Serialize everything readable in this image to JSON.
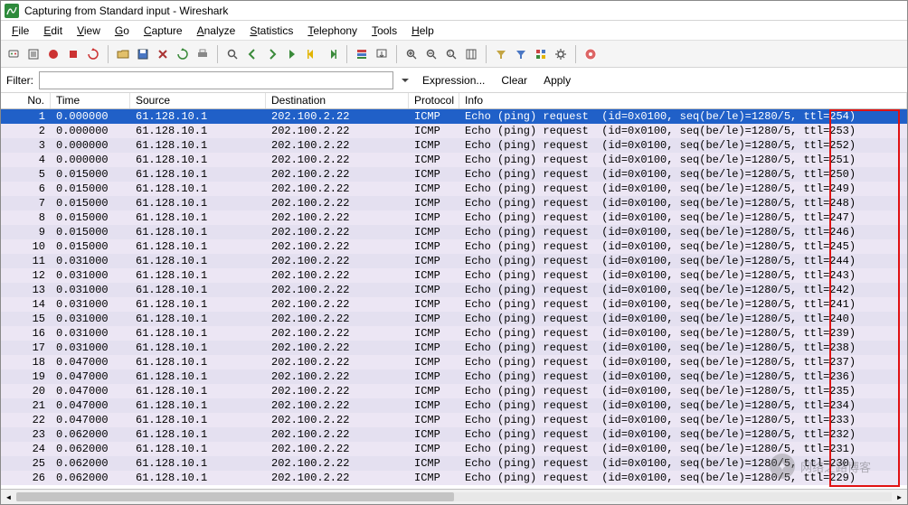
{
  "window": {
    "title": "Capturing from Standard input - Wireshark"
  },
  "menu": {
    "items": [
      "File",
      "Edit",
      "View",
      "Go",
      "Capture",
      "Analyze",
      "Statistics",
      "Telephony",
      "Tools",
      "Help"
    ]
  },
  "toolbar": {
    "groups": [
      [
        "interfaces-icon",
        "options-icon",
        "start-capture-icon",
        "stop-capture-icon",
        "restart-capture-icon"
      ],
      [
        "open-file-icon",
        "save-file-icon",
        "close-file-icon",
        "reload-icon",
        "print-icon"
      ],
      [
        "find-icon",
        "go-back-icon",
        "go-forward-icon",
        "go-to-icon",
        "go-first-icon",
        "go-last-icon"
      ],
      [
        "colorize-icon",
        "auto-scroll-icon"
      ],
      [
        "zoom-in-icon",
        "zoom-out-icon",
        "zoom-reset-icon",
        "resize-columns-icon"
      ],
      [
        "capture-filter-icon",
        "display-filter-icon",
        "coloring-rules-icon",
        "preferences-icon"
      ],
      [
        "help-icon"
      ]
    ]
  },
  "filter": {
    "label": "Filter:",
    "value": "",
    "expression": "Expression...",
    "clear": "Clear",
    "apply": "Apply"
  },
  "columns": [
    "No.",
    "Time",
    "Source",
    "Destination",
    "Protocol",
    "Info"
  ],
  "packets": [
    {
      "no": 1,
      "time": "0.000000",
      "src": "61.128.10.1",
      "dst": "202.100.2.22",
      "proto": "ICMP",
      "info": "Echo (ping) request  (id=0x0100, seq(be/le)=1280/5, ttl=254)",
      "selected": true
    },
    {
      "no": 2,
      "time": "0.000000",
      "src": "61.128.10.1",
      "dst": "202.100.2.22",
      "proto": "ICMP",
      "info": "Echo (ping) request  (id=0x0100, seq(be/le)=1280/5, ttl=253)"
    },
    {
      "no": 3,
      "time": "0.000000",
      "src": "61.128.10.1",
      "dst": "202.100.2.22",
      "proto": "ICMP",
      "info": "Echo (ping) request  (id=0x0100, seq(be/le)=1280/5, ttl=252)"
    },
    {
      "no": 4,
      "time": "0.000000",
      "src": "61.128.10.1",
      "dst": "202.100.2.22",
      "proto": "ICMP",
      "info": "Echo (ping) request  (id=0x0100, seq(be/le)=1280/5, ttl=251)"
    },
    {
      "no": 5,
      "time": "0.015000",
      "src": "61.128.10.1",
      "dst": "202.100.2.22",
      "proto": "ICMP",
      "info": "Echo (ping) request  (id=0x0100, seq(be/le)=1280/5, ttl=250)"
    },
    {
      "no": 6,
      "time": "0.015000",
      "src": "61.128.10.1",
      "dst": "202.100.2.22",
      "proto": "ICMP",
      "info": "Echo (ping) request  (id=0x0100, seq(be/le)=1280/5, ttl=249)"
    },
    {
      "no": 7,
      "time": "0.015000",
      "src": "61.128.10.1",
      "dst": "202.100.2.22",
      "proto": "ICMP",
      "info": "Echo (ping) request  (id=0x0100, seq(be/le)=1280/5, ttl=248)"
    },
    {
      "no": 8,
      "time": "0.015000",
      "src": "61.128.10.1",
      "dst": "202.100.2.22",
      "proto": "ICMP",
      "info": "Echo (ping) request  (id=0x0100, seq(be/le)=1280/5, ttl=247)"
    },
    {
      "no": 9,
      "time": "0.015000",
      "src": "61.128.10.1",
      "dst": "202.100.2.22",
      "proto": "ICMP",
      "info": "Echo (ping) request  (id=0x0100, seq(be/le)=1280/5, ttl=246)"
    },
    {
      "no": 10,
      "time": "0.015000",
      "src": "61.128.10.1",
      "dst": "202.100.2.22",
      "proto": "ICMP",
      "info": "Echo (ping) request  (id=0x0100, seq(be/le)=1280/5, ttl=245)"
    },
    {
      "no": 11,
      "time": "0.031000",
      "src": "61.128.10.1",
      "dst": "202.100.2.22",
      "proto": "ICMP",
      "info": "Echo (ping) request  (id=0x0100, seq(be/le)=1280/5, ttl=244)"
    },
    {
      "no": 12,
      "time": "0.031000",
      "src": "61.128.10.1",
      "dst": "202.100.2.22",
      "proto": "ICMP",
      "info": "Echo (ping) request  (id=0x0100, seq(be/le)=1280/5, ttl=243)"
    },
    {
      "no": 13,
      "time": "0.031000",
      "src": "61.128.10.1",
      "dst": "202.100.2.22",
      "proto": "ICMP",
      "info": "Echo (ping) request  (id=0x0100, seq(be/le)=1280/5, ttl=242)"
    },
    {
      "no": 14,
      "time": "0.031000",
      "src": "61.128.10.1",
      "dst": "202.100.2.22",
      "proto": "ICMP",
      "info": "Echo (ping) request  (id=0x0100, seq(be/le)=1280/5, ttl=241)"
    },
    {
      "no": 15,
      "time": "0.031000",
      "src": "61.128.10.1",
      "dst": "202.100.2.22",
      "proto": "ICMP",
      "info": "Echo (ping) request  (id=0x0100, seq(be/le)=1280/5, ttl=240)"
    },
    {
      "no": 16,
      "time": "0.031000",
      "src": "61.128.10.1",
      "dst": "202.100.2.22",
      "proto": "ICMP",
      "info": "Echo (ping) request  (id=0x0100, seq(be/le)=1280/5, ttl=239)"
    },
    {
      "no": 17,
      "time": "0.031000",
      "src": "61.128.10.1",
      "dst": "202.100.2.22",
      "proto": "ICMP",
      "info": "Echo (ping) request  (id=0x0100, seq(be/le)=1280/5, ttl=238)"
    },
    {
      "no": 18,
      "time": "0.047000",
      "src": "61.128.10.1",
      "dst": "202.100.2.22",
      "proto": "ICMP",
      "info": "Echo (ping) request  (id=0x0100, seq(be/le)=1280/5, ttl=237)"
    },
    {
      "no": 19,
      "time": "0.047000",
      "src": "61.128.10.1",
      "dst": "202.100.2.22",
      "proto": "ICMP",
      "info": "Echo (ping) request  (id=0x0100, seq(be/le)=1280/5, ttl=236)"
    },
    {
      "no": 20,
      "time": "0.047000",
      "src": "61.128.10.1",
      "dst": "202.100.2.22",
      "proto": "ICMP",
      "info": "Echo (ping) request  (id=0x0100, seq(be/le)=1280/5, ttl=235)"
    },
    {
      "no": 21,
      "time": "0.047000",
      "src": "61.128.10.1",
      "dst": "202.100.2.22",
      "proto": "ICMP",
      "info": "Echo (ping) request  (id=0x0100, seq(be/le)=1280/5, ttl=234)"
    },
    {
      "no": 22,
      "time": "0.047000",
      "src": "61.128.10.1",
      "dst": "202.100.2.22",
      "proto": "ICMP",
      "info": "Echo (ping) request  (id=0x0100, seq(be/le)=1280/5, ttl=233)"
    },
    {
      "no": 23,
      "time": "0.062000",
      "src": "61.128.10.1",
      "dst": "202.100.2.22",
      "proto": "ICMP",
      "info": "Echo (ping) request  (id=0x0100, seq(be/le)=1280/5, ttl=232)"
    },
    {
      "no": 24,
      "time": "0.062000",
      "src": "61.128.10.1",
      "dst": "202.100.2.22",
      "proto": "ICMP",
      "info": "Echo (ping) request  (id=0x0100, seq(be/le)=1280/5, ttl=231)"
    },
    {
      "no": 25,
      "time": "0.062000",
      "src": "61.128.10.1",
      "dst": "202.100.2.22",
      "proto": "ICMP",
      "info": "Echo (ping) request  (id=0x0100, seq(be/le)=1280/5, ttl=230)"
    },
    {
      "no": 26,
      "time": "0.062000",
      "src": "61.128.10.1",
      "dst": "202.100.2.22",
      "proto": "ICMP",
      "info": "Echo (ping) request  (id=0x0100, seq(be/le)=1280/5, ttl=229)"
    }
  ],
  "watermark": {
    "text": "网络之路博客"
  }
}
